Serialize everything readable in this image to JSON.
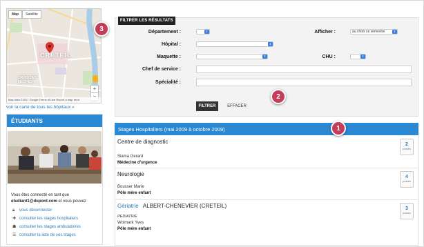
{
  "map": {
    "tabs": [
      "Map",
      "Satellite"
    ],
    "city_label": "CRÉTEIL",
    "district_label": "CROIX DES MÈCHES",
    "footer": "Map data ©2017 Google   Terms of Use   Report a map error",
    "zoom_in": "+",
    "zoom_out": "−",
    "link": "voir la carte de tous les hôpitaux »"
  },
  "students": {
    "title": "ÉTUDIANTS",
    "connected_prefix": "Vous êtes connecté en tant que",
    "user_email": "etudiant1@dupont.com",
    "connected_suffix": " et vous pouvez",
    "links": [
      {
        "label": "vous déconnecter",
        "icon": "lock-icon"
      },
      {
        "label": "consulter les stages hospitaliers",
        "icon": "hospital-icon"
      },
      {
        "label": "consulter les stages ambulatoires",
        "icon": "doctor-icon"
      },
      {
        "label": "consulter la liste de vos stages",
        "icon": "list-icon"
      }
    ]
  },
  "filter": {
    "title": "FILTRER LES RÉSULTATS",
    "departement_label": "Département :",
    "hopital_label": "Hôpital :",
    "maquette_label": "Maquette :",
    "chef_label": "Chef de service :",
    "specialite_label": "Spécialité :",
    "afficher_label": "Afficher :",
    "afficher_value": "au choix ce semestre",
    "chu_label": "CHU :",
    "btn_filtrer": "FILTRER",
    "btn_effacer": "EFFACER"
  },
  "results": {
    "title": "Stages Hospitaliers (mai 2009 à octobre 2009)",
    "postes_label": "postes",
    "items": [
      {
        "title": "Centre de diagnostic",
        "person": "Slama Gerard",
        "service": "Médecine d'urgence",
        "count": "2"
      },
      {
        "title": "Neurologie",
        "person": "Bousser Marie",
        "service": "Pôle mère enfant",
        "count": "4"
      },
      {
        "link": "Gériatrie",
        "title": "ALBERT-CHENEVIER (CRETEIL)",
        "specialty": "PEDIATRIE",
        "person": "Wolmark Yves",
        "service": "Pôle mère enfant",
        "count": "3"
      }
    ]
  },
  "callouts": [
    "1",
    "2",
    "3"
  ],
  "colors": {
    "header_blue": "#2b88d3",
    "callout": "#c43c58",
    "link": "#2a7ab5",
    "select_arrow": "#3b7fe0"
  }
}
